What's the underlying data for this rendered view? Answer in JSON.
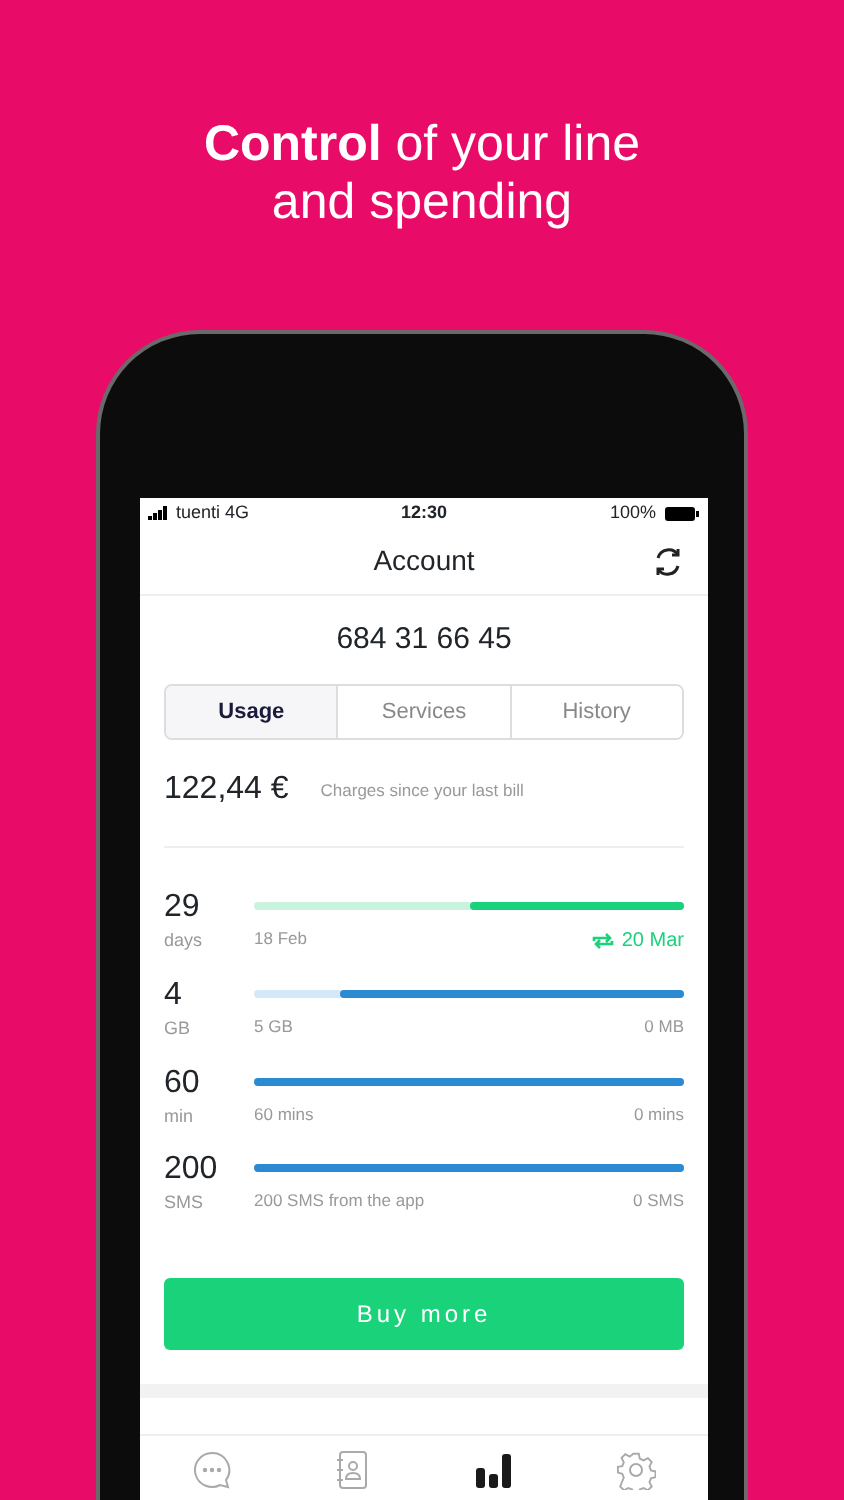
{
  "headline": "**Control** of your line and spending",
  "status_bar": {
    "carrier": "tuenti 4G",
    "time": "12:30",
    "battery": "100%"
  },
  "header": {
    "title": "Account"
  },
  "phone_number": "684 31 66 45",
  "tabs": [
    {
      "label": "Usage",
      "selected": true
    },
    {
      "label": "Services",
      "selected": false
    },
    {
      "label": "History",
      "selected": false
    }
  ],
  "charges": {
    "amount": "122,44 €",
    "caption": "Charges since your last bill"
  },
  "meters": [
    {
      "value": "29",
      "unit": "days",
      "start": "18 Feb",
      "end": "20 Mar",
      "kind": "renewal",
      "level": 0.5
    },
    {
      "value": "4",
      "unit": "GB",
      "start": "5 GB",
      "end": "0 MB",
      "kind": "allowance",
      "level": 0.8
    },
    {
      "value": "60",
      "unit": "min",
      "start": "60 mins",
      "end": "0 mins",
      "kind": "allowance",
      "level": 1
    },
    {
      "value": "200",
      "unit": "SMS",
      "start": "200 SMS from the app",
      "end": "0 SMS",
      "kind": "allowance",
      "level": 1
    }
  ],
  "buy_button": "Buy more",
  "bottom_nav": [
    {
      "kind": "chat",
      "selected": false
    },
    {
      "kind": "contacts",
      "selected": false
    },
    {
      "kind": "usage",
      "selected": true
    },
    {
      "kind": "settings",
      "selected": false
    }
  ]
}
